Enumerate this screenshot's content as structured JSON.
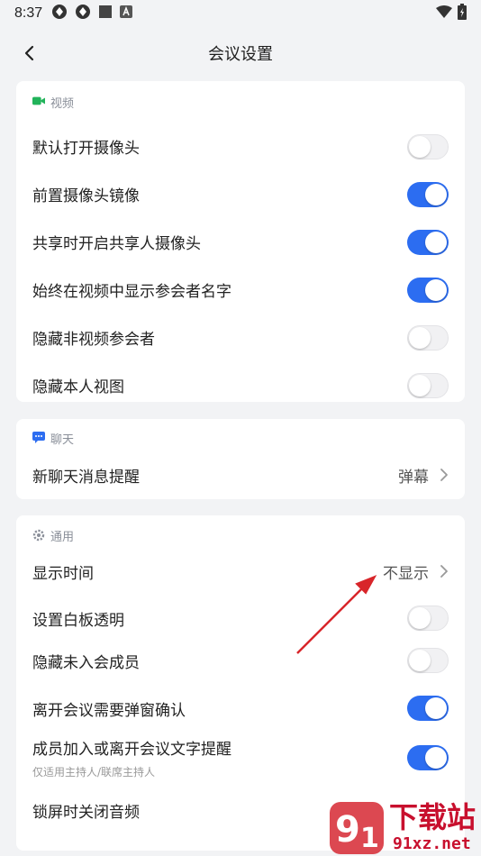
{
  "status_bar": {
    "time": "8:37"
  },
  "header": {
    "title": "会议设置"
  },
  "sections": {
    "video": {
      "title": "视频",
      "items": [
        {
          "label": "默认打开摄像头",
          "on": false
        },
        {
          "label": "前置摄像头镜像",
          "on": true
        },
        {
          "label": "共享时开启共享人摄像头",
          "on": true
        },
        {
          "label": "始终在视频中显示参会者名字",
          "on": true
        },
        {
          "label": "隐藏非视频参会者",
          "on": false
        },
        {
          "label": "隐藏本人视图",
          "on": false
        }
      ]
    },
    "chat": {
      "title": "聊天",
      "items": [
        {
          "label": "新聊天消息提醒",
          "value": "弹幕"
        }
      ]
    },
    "general": {
      "title": "通用",
      "items": [
        {
          "label": "显示时间",
          "value": "不显示"
        },
        {
          "label": "设置白板透明",
          "on": false
        },
        {
          "label": "隐藏未入会成员",
          "on": false
        },
        {
          "label": "离开会议需要弹窗确认",
          "on": true
        },
        {
          "label": "成员加入或离开会议文字提醒",
          "sub": "仅适用主持人/联席主持人",
          "on": true
        },
        {
          "label": "锁屏时关闭音频"
        }
      ]
    }
  },
  "watermark": {
    "text": "下载站",
    "url": "91xz.net"
  },
  "colors": {
    "accent": "#2c6df1",
    "video_icon": "#21b35a",
    "chat_icon": "#2c6df1",
    "annotation_arrow": "#d8252a"
  }
}
